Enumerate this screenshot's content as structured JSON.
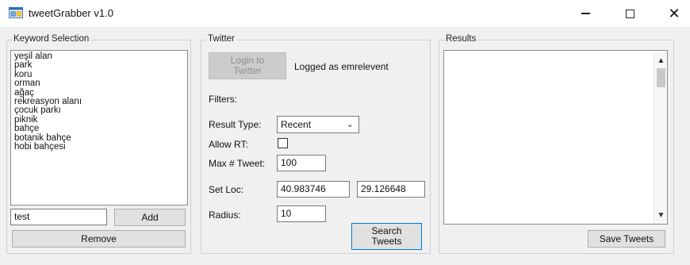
{
  "window": {
    "title": "tweetGrabber v1.0",
    "icon": "app-window-icon",
    "minimize_glyph": "—",
    "close_glyph": "✕"
  },
  "keyword": {
    "group_label": "Keyword Selection",
    "items": [
      "yeşil alan",
      "park",
      "koru",
      "orman",
      "ağaç",
      "rekreasyon alanı",
      "çocuk parkı",
      "piknik",
      "bahçe",
      "botanik bahçe",
      "hobi bahçesi"
    ],
    "input_value": "test",
    "add_label": "Add",
    "remove_label": "Remove"
  },
  "twitter": {
    "group_label": "Twitter",
    "login_label": "Login to\nTwitter",
    "logged_as": "Logged as emrelevent",
    "filters_label": "Filters:",
    "result_type_label": "Result Type:",
    "result_type_value": "Recent",
    "allow_rt_label": "Allow RT:",
    "allow_rt_checked": false,
    "max_tweet_label": "Max # Tweet:",
    "max_tweet_value": "100",
    "set_loc_label": "Set Loc:",
    "lat_value": "40.983746",
    "lon_value": "29.126648",
    "radius_label": "Radius:",
    "radius_value": "10",
    "search_label": "Search\nTweets"
  },
  "results": {
    "group_label": "Results",
    "save_label": "Save Tweets"
  }
}
